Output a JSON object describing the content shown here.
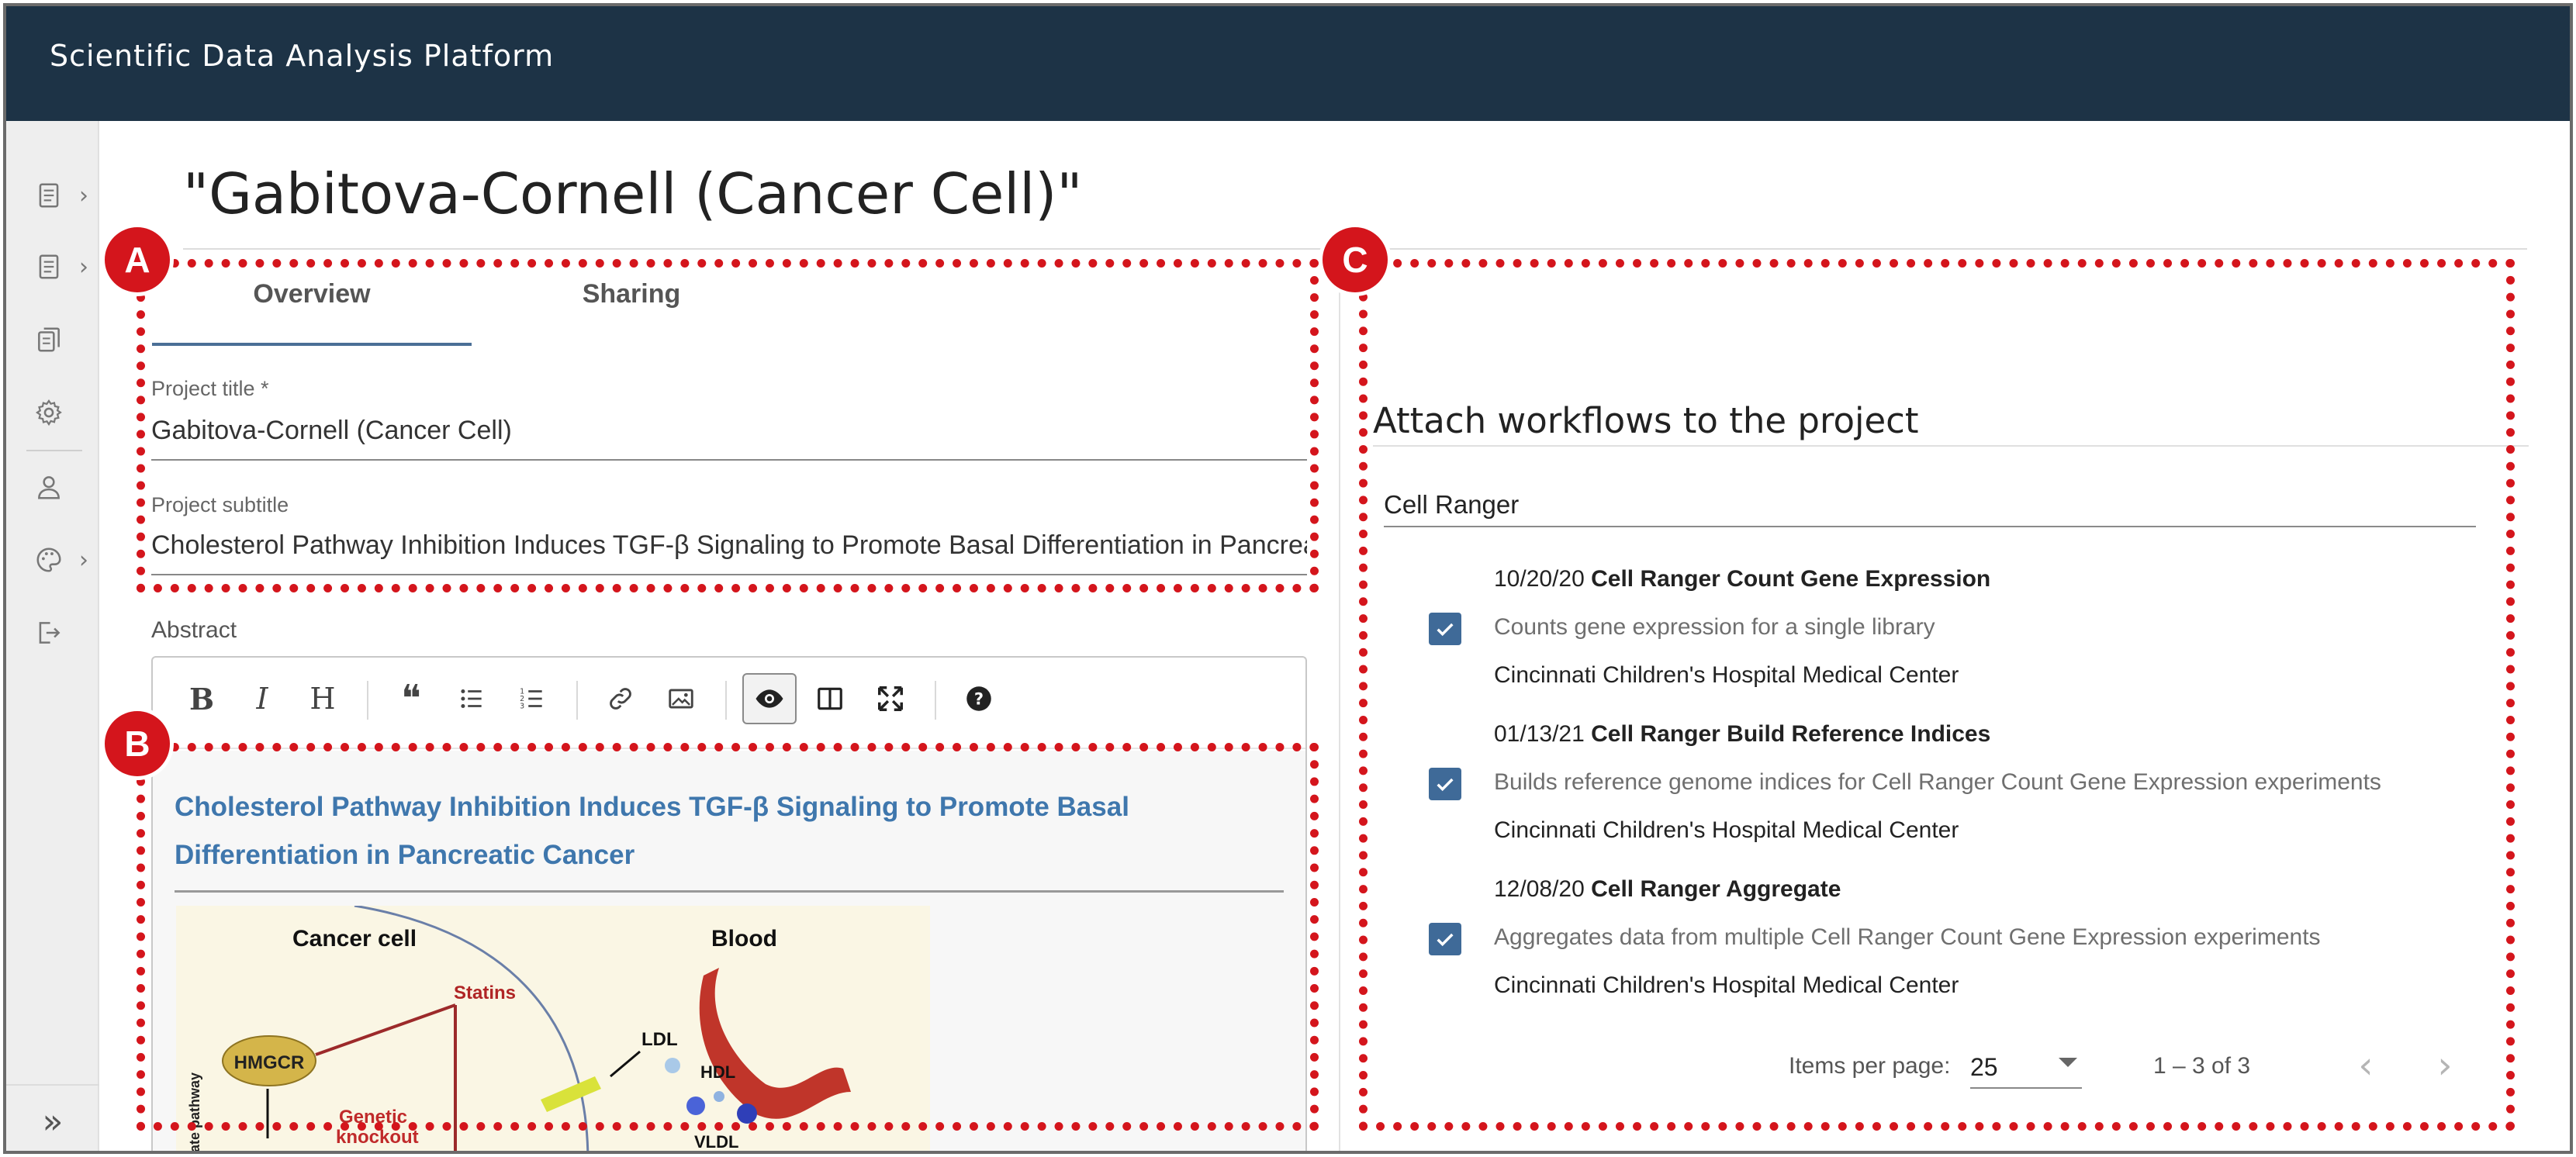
{
  "app": {
    "title": "Scientific Data Analysis Platform"
  },
  "sidebar": {
    "items": [
      {
        "icon": "document-icon",
        "has_chevron": true
      },
      {
        "icon": "document-icon",
        "has_chevron": true
      },
      {
        "icon": "copy-icon",
        "has_chevron": false
      },
      {
        "icon": "gear-icon",
        "has_chevron": false
      },
      {
        "icon": "person-icon",
        "has_chevron": false
      },
      {
        "icon": "palette-icon",
        "has_chevron": true
      },
      {
        "icon": "logout-icon",
        "has_chevron": false
      }
    ],
    "chevron": "›",
    "expand_glyph": "»"
  },
  "page": {
    "title": "\"Gabitova-Cornell (Cancer Cell)\""
  },
  "tabs": {
    "overview": "Overview",
    "sharing": "Sharing",
    "active": "Overview"
  },
  "form": {
    "project_title_label": "Project title *",
    "project_title_value": "Gabitova-Cornell (Cancer Cell)",
    "project_subtitle_label": "Project subtitle",
    "project_subtitle_value": "Cholesterol Pathway Inhibition Induces TGF-β Signaling to Promote Basal Differentiation in Pancreatic Cancer",
    "abstract_label": "Abstract"
  },
  "editor": {
    "toolbar": {
      "bold": "B",
      "italic": "I",
      "heading": "H",
      "quote": "❝",
      "bulleted_list": "list",
      "numbered_list": "numbered-list",
      "link": "link",
      "image": "image",
      "preview": "eye",
      "side_by_side": "columns",
      "fullscreen": "expand",
      "help": "?"
    },
    "preview_heading": "Cholesterol Pathway Inhibition Induces TGF-β Signaling to Promote Basal Differentiation in Pancreatic Cancer",
    "figure": {
      "cancer_cell": "Cancer cell",
      "blood": "Blood",
      "statins": "Statins",
      "hmgcr": "HMGCR",
      "ldl": "LDL",
      "hdl": "HDL",
      "vldl": "VLDL",
      "genetic": "Genetic",
      "knockout": "knockout",
      "pathway": "onate pathway"
    }
  },
  "workflows": {
    "heading": "Attach workflows to the project",
    "search_value": "Cell Ranger",
    "items": [
      {
        "date": "10/20/20",
        "name": "Cell Ranger Count Gene Expression",
        "description": "Counts gene expression for a single library",
        "organization": "Cincinnati Children's Hospital Medical Center",
        "checked": true
      },
      {
        "date": "01/13/21",
        "name": "Cell Ranger Build Reference Indices",
        "description": "Builds reference genome indices for Cell Ranger Count Gene Expression experiments",
        "organization": "Cincinnati Children's Hospital Medical Center",
        "checked": true
      },
      {
        "date": "12/08/20",
        "name": "Cell Ranger Aggregate",
        "description": "Aggregates data from multiple Cell Ranger Count Gene Expression experiments",
        "organization": "Cincinnati Children's Hospital Medical Center",
        "checked": true
      }
    ]
  },
  "paginator": {
    "items_per_page_label": "Items per page:",
    "page_size": "25",
    "range": "1 – 3 of 3",
    "prev": "‹",
    "next": "›"
  },
  "callouts": {
    "a": "A",
    "b": "B",
    "c": "C"
  },
  "colors": {
    "topbar": "#1d3346",
    "accent": "#3f6a98",
    "callout": "#d4151c",
    "link_heading": "#3f77ad"
  }
}
